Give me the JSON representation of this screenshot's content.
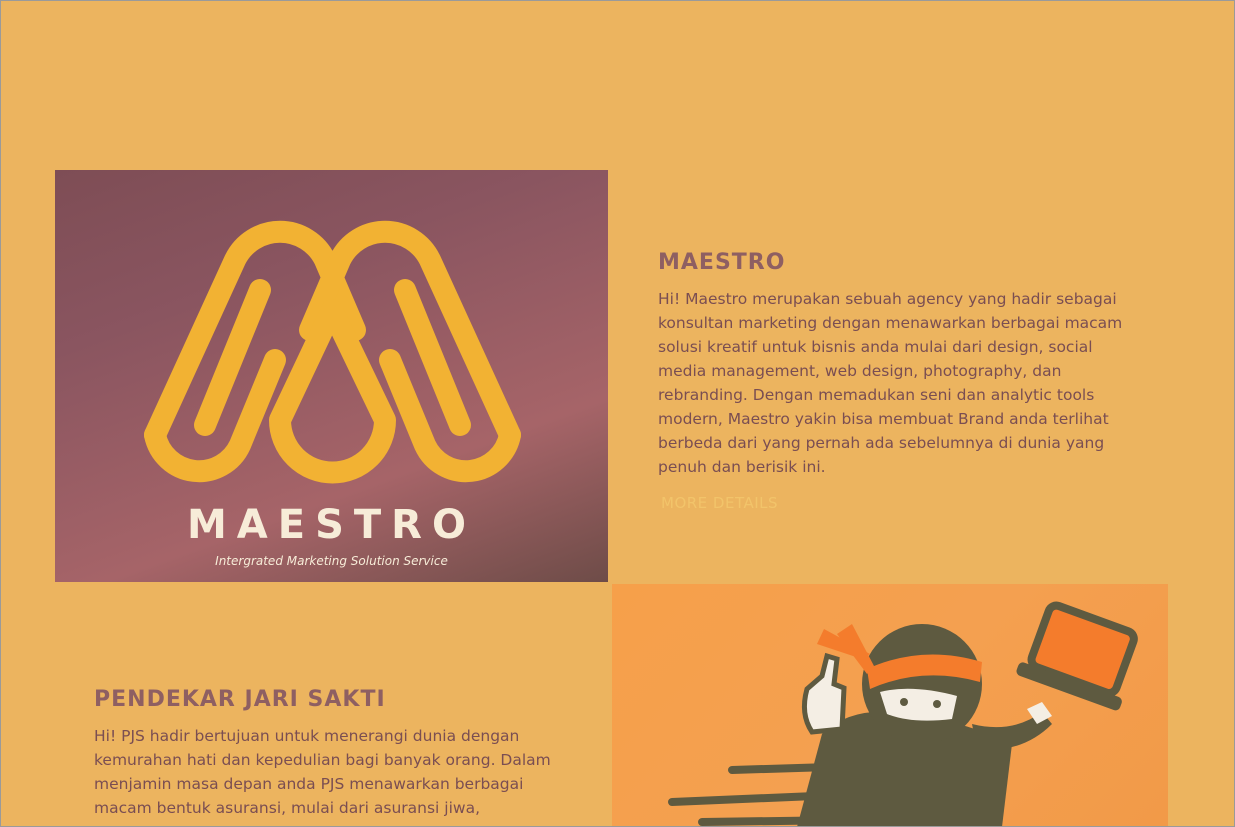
{
  "maestro": {
    "logo_word": "MAESTRO",
    "logo_tagline": "Intergrated Marketing Solution Service",
    "title": "MAESTRO",
    "description": "Hi! Maestro merupakan sebuah agency yang hadir sebagai konsultan marketing dengan menawarkan berbagai macam solusi kreatif untuk bisnis anda mulai dari design, social media management, web design, photography, dan rebranding. Dengan memadukan seni dan analytic tools modern, Maestro yakin bisa membuat Brand anda terlihat berbeda dari yang pernah ada sebelumnya di dunia yang penuh dan berisik ini.",
    "more_details": "MORE DETAILS"
  },
  "pjs": {
    "title": "PENDEKAR JARI SAKTI",
    "description": "Hi! PJS hadir bertujuan untuk menerangi dunia dengan kemurahan hati dan kepedulian bagi banyak orang. Dalam menjamin masa depan anda PJS menawarkan berbagai macam bentuk asuransi, mulai dari asuransi jiwa,"
  },
  "colors": {
    "background": "#ecb45f",
    "heading": "#8e5f62",
    "body_text": "#7a4e52",
    "link": "#f2c46a",
    "logo_gold": "#f2b233",
    "pjs_orange": "#f6a04a",
    "ninja_body": "#5e5a40"
  },
  "icons": {
    "maestro_logo": "maestro-m-logo",
    "pjs_mascot": "ninja-mascot"
  }
}
